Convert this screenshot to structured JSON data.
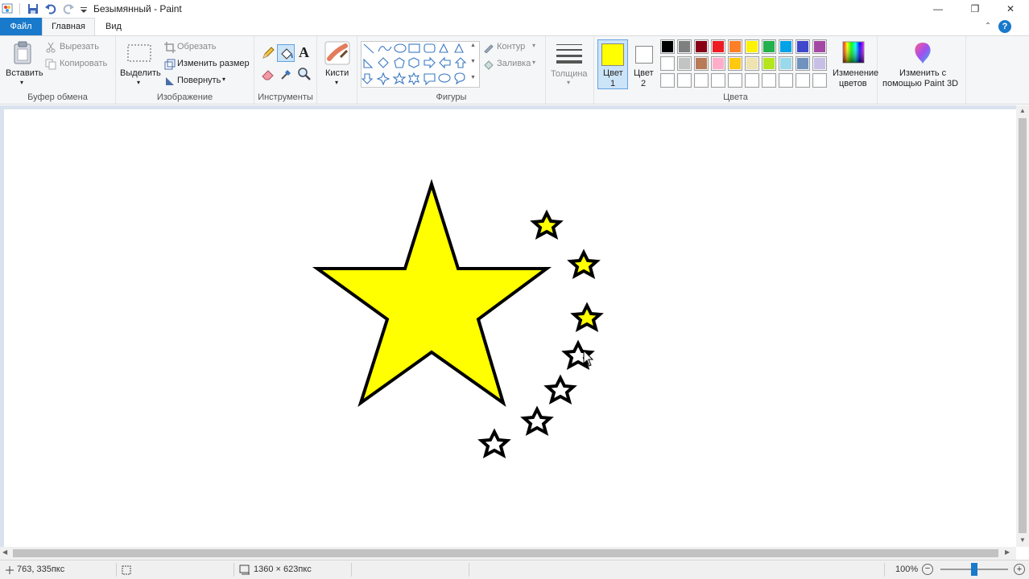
{
  "titlebar": {
    "title": "Безымянный - Paint",
    "minimize_icon": "minimize-icon",
    "maximize_icon": "restore-icon",
    "close_icon": "close-icon",
    "minimize_glyph": "—",
    "restore_glyph": "❐",
    "close_glyph": "✕"
  },
  "tabs": {
    "file": "Файл",
    "home": "Главная",
    "view": "Вид",
    "help_glyph": "?",
    "collapse_glyph": "⌃"
  },
  "ribbon": {
    "clipboard": {
      "group_label": "Буфер обмена",
      "paste": "Вставить",
      "cut": "Вырезать",
      "copy": "Копировать"
    },
    "image": {
      "group_label": "Изображение",
      "select": "Выделить",
      "crop": "Обрезать",
      "resize": "Изменить размер",
      "rotate": "Повернуть"
    },
    "tools": {
      "group_label": "Инструменты",
      "text_glyph": "A"
    },
    "brushes": {
      "label": "Кисти"
    },
    "shapes": {
      "group_label": "Фигуры",
      "outline": "Контур",
      "fill": "Заливка"
    },
    "size": {
      "label": "Толщина"
    },
    "colors": {
      "group_label": "Цвета",
      "color1_line1": "Цвет",
      "color1_line2": "1",
      "color2_line1": "Цвет",
      "color2_line2": "2",
      "color1": "#ffff00",
      "color2": "#ffffff",
      "edit_line1": "Изменение",
      "edit_line2": "цветов",
      "palette_row1": [
        "#000000",
        "#7f7f7f",
        "#880015",
        "#ed1c24",
        "#ff7f27",
        "#fff200",
        "#22b14c",
        "#00a2e8",
        "#3f48cc",
        "#a349a4"
      ],
      "palette_row2": [
        "#ffffff",
        "#c3c3c3",
        "#b97a57",
        "#ffaec9",
        "#ffc90e",
        "#efe4b0",
        "#b5e61d",
        "#99d9ea",
        "#7092be",
        "#c8bfe7"
      ],
      "palette_row3": [
        "#ffffff",
        "#ffffff",
        "#ffffff",
        "#ffffff",
        "#ffffff",
        "#ffffff",
        "#ffffff",
        "#ffffff",
        "#ffffff",
        "#ffffff"
      ]
    },
    "paint3d": {
      "line1": "Изменить с",
      "line2": "помощью Paint 3D"
    }
  },
  "canvas": {
    "star_fill": "#ffff00",
    "outline": "#000000"
  },
  "statusbar": {
    "cursor_pos": "763, 335пкс",
    "image_size": "1360 × 623пкс",
    "zoom": "100%",
    "zoom_level": 1.0
  }
}
